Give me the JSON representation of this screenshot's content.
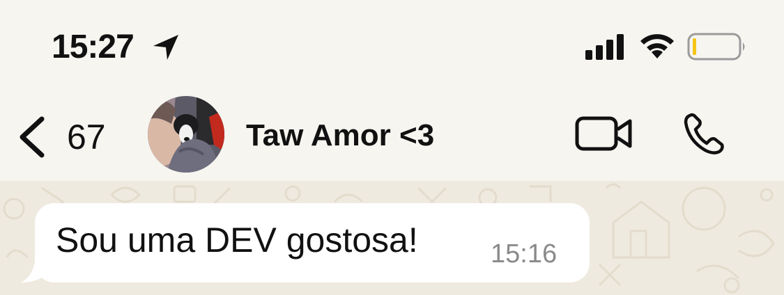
{
  "status_bar": {
    "time": "15:27",
    "icons": [
      "location-arrow-icon",
      "signal-icon",
      "wifi-icon",
      "battery-icon"
    ],
    "battery_level": 0.05,
    "battery_color": "#f5c518"
  },
  "header": {
    "back_icon": "chevron-left-icon",
    "unread_count": "67",
    "contact_name": "Taw Amor <3",
    "actions": [
      "video-call-icon",
      "phone-icon"
    ]
  },
  "chat": {
    "wallpaper_color": "#efeadf",
    "messages": [
      {
        "text": "Sou uma DEV gostosa!",
        "time": "15:16",
        "direction": "incoming"
      }
    ]
  }
}
